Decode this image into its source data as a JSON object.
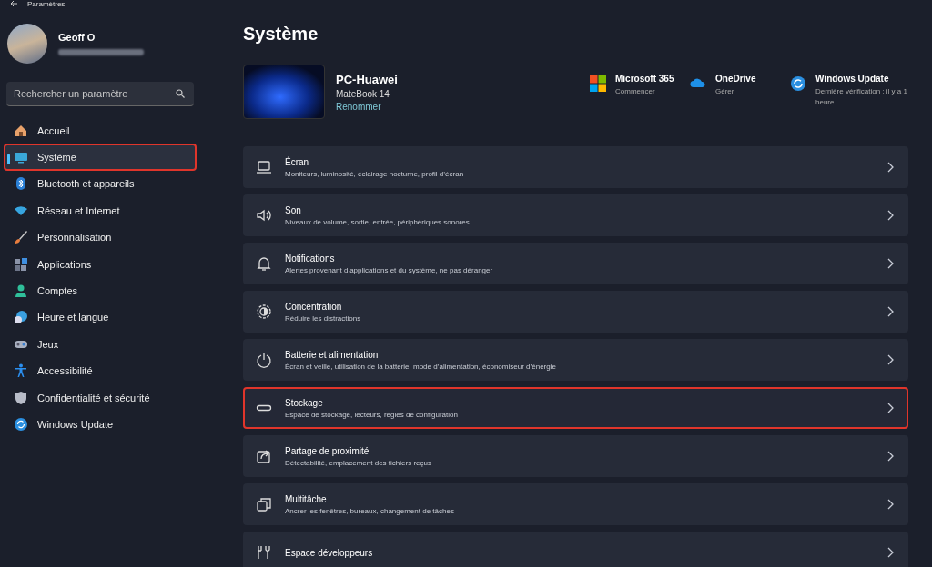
{
  "window": {
    "title": "Paramètres"
  },
  "account": {
    "name": "Geoff O"
  },
  "search": {
    "placeholder": "Rechercher un paramètre"
  },
  "sidebar": {
    "items": [
      {
        "label": "Accueil",
        "selected": false,
        "highlighted": false
      },
      {
        "label": "Système",
        "selected": true,
        "highlighted": true
      },
      {
        "label": "Bluetooth et appareils",
        "selected": false,
        "highlighted": false
      },
      {
        "label": "Réseau et Internet",
        "selected": false,
        "highlighted": false
      },
      {
        "label": "Personnalisation",
        "selected": false,
        "highlighted": false
      },
      {
        "label": "Applications",
        "selected": false,
        "highlighted": false
      },
      {
        "label": "Comptes",
        "selected": false,
        "highlighted": false
      },
      {
        "label": "Heure et langue",
        "selected": false,
        "highlighted": false
      },
      {
        "label": "Jeux",
        "selected": false,
        "highlighted": false
      },
      {
        "label": "Accessibilité",
        "selected": false,
        "highlighted": false
      },
      {
        "label": "Confidentialité et sécurité",
        "selected": false,
        "highlighted": false
      },
      {
        "label": "Windows Update",
        "selected": false,
        "highlighted": false
      }
    ]
  },
  "page_title": "Système",
  "device": {
    "name": "PC-Huawei",
    "model": "MateBook 14",
    "rename_link": "Renommer"
  },
  "quick_links": [
    {
      "title": "Microsoft 365",
      "subtitle": "Commencer"
    },
    {
      "title": "OneDrive",
      "subtitle": "Gérer"
    },
    {
      "title": "Windows Update",
      "subtitle": "Dernière vérification : il y a 1 heure"
    }
  ],
  "settings": [
    {
      "title": "Écran",
      "description": "Moniteurs, luminosité, éclairage nocturne, profil d’écran",
      "highlighted": false
    },
    {
      "title": "Son",
      "description": "Niveaux de volume, sortie, entrée, périphériques sonores",
      "highlighted": false
    },
    {
      "title": "Notifications",
      "description": "Alertes provenant d’applications et du système, ne pas déranger",
      "highlighted": false
    },
    {
      "title": "Concentration",
      "description": "Réduire les distractions",
      "highlighted": false
    },
    {
      "title": "Batterie et alimentation",
      "description": "Écran et veille, utilisation de la batterie, mode d’alimentation, économiseur d’énergie",
      "highlighted": false
    },
    {
      "title": "Stockage",
      "description": "Espace de stockage, lecteurs, règles de configuration",
      "highlighted": true
    },
    {
      "title": "Partage de proximité",
      "description": "Détectabilité, emplacement des fichiers reçus",
      "highlighted": false
    },
    {
      "title": "Multitâche",
      "description": "Ancrer les fenêtres, bureaux, changement de tâches",
      "highlighted": false
    },
    {
      "title": "Espace développeurs",
      "highlighted": false
    }
  ]
}
